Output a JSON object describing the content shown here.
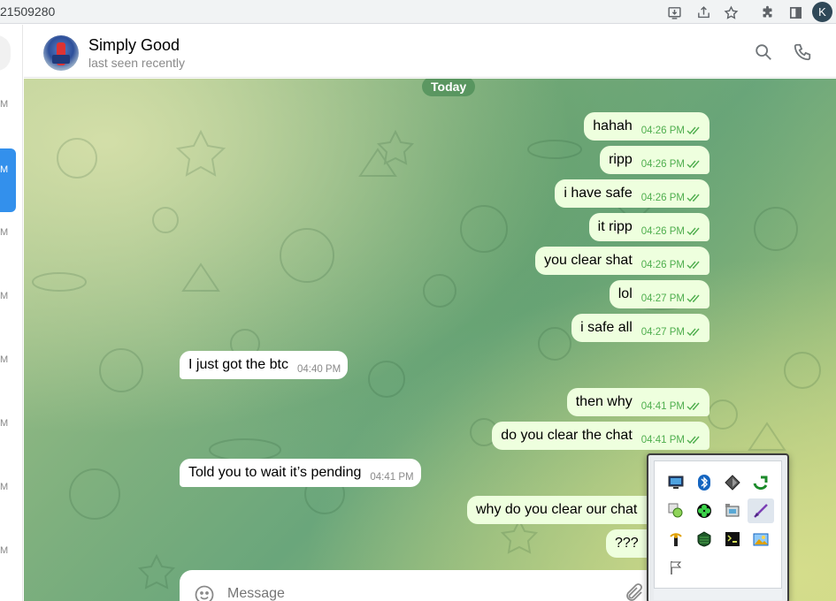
{
  "browser": {
    "url_fragment": "21509280",
    "profile_initial": "K"
  },
  "sidebar": {
    "times": [
      "M",
      "M",
      "M",
      "M",
      "M",
      "M",
      "M",
      "M"
    ]
  },
  "header": {
    "name": "Simply Good",
    "status": "last seen recently"
  },
  "chat": {
    "date_label": "Today",
    "messages": [
      {
        "dir": "out",
        "text": "hahah",
        "time": "04:26 PM"
      },
      {
        "dir": "out",
        "text": "ripp",
        "time": "04:26 PM"
      },
      {
        "dir": "out",
        "text": "i have safe",
        "time": "04:26 PM"
      },
      {
        "dir": "out",
        "text": "it ripp",
        "time": "04:26 PM"
      },
      {
        "dir": "out",
        "text": "you clear shat",
        "time": "04:26 PM"
      },
      {
        "dir": "out",
        "text": "lol",
        "time": "04:27 PM"
      },
      {
        "dir": "out",
        "text": "i safe all",
        "time": "04:27 PM"
      },
      {
        "dir": "in",
        "text": "I just got the btc",
        "time": "04:40 PM"
      },
      {
        "dir": "out",
        "text": "then why",
        "time": "04:41 PM"
      },
      {
        "dir": "out",
        "text": "do you clear the chat",
        "time": "04:41 PM"
      },
      {
        "dir": "in",
        "text": "Told you to wait it’s pending",
        "time": "04:41 PM"
      },
      {
        "dir": "out",
        "text": "why do you clear our chat",
        "time": ""
      },
      {
        "dir": "out",
        "text": "???",
        "time": ""
      }
    ]
  },
  "composer": {
    "placeholder": "Message"
  },
  "colors": {
    "out_bubble": "#eeffde",
    "in_bubble": "#ffffff",
    "accent": "#3390ec",
    "tick_green": "#4fae4e"
  },
  "tray": {
    "icons": [
      "monitor-icon",
      "bluetooth-icon",
      "diamond-icon",
      "refresh-app-icon",
      "green-circle-icon",
      "clover-icon",
      "usb-drive-icon",
      "pen-icon",
      "antenna-icon",
      "shield-icon",
      "terminal-icon",
      "photo-icon",
      "flag-icon"
    ]
  }
}
